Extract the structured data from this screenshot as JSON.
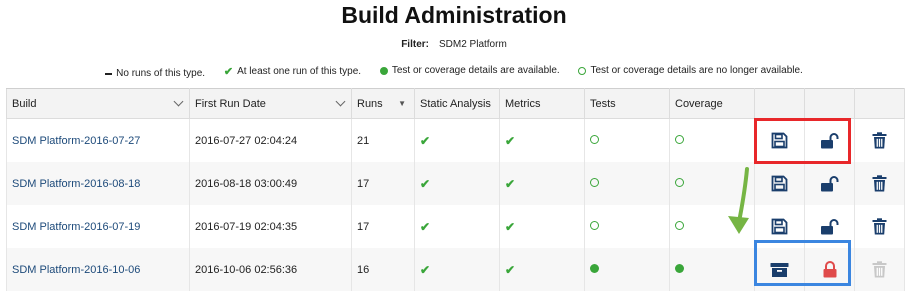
{
  "title": "Build Administration",
  "filter": {
    "label": "Filter:",
    "value": "SDM2 Platform"
  },
  "legend": [
    {
      "symbol": "dash-icon",
      "text": "No runs of this type."
    },
    {
      "symbol": "check-icon",
      "text": "At least one run of this type."
    },
    {
      "symbol": "filled-dot-icon",
      "text": "Test or coverage details are available."
    },
    {
      "symbol": "hollow-dot-icon",
      "text": "Test or coverage details are no longer available."
    }
  ],
  "columns": {
    "build": "Build",
    "first_run": "First Run Date",
    "runs": "Runs",
    "static": "Static Analysis",
    "metrics": "Metrics",
    "tests": "Tests",
    "coverage": "Coverage"
  },
  "rows": [
    {
      "build": "SDM Platform-2016-07-27",
      "first_run": "2016-07-27 02:04:24",
      "runs": "21",
      "static": "check",
      "metrics": "check",
      "tests": "hollow",
      "coverage": "hollow",
      "archive_state": "save",
      "lock_state": "unlocked",
      "delete_enabled": true
    },
    {
      "build": "SDM Platform-2016-08-18",
      "first_run": "2016-08-18 03:00:49",
      "runs": "17",
      "static": "check",
      "metrics": "check",
      "tests": "hollow",
      "coverage": "hollow",
      "archive_state": "save",
      "lock_state": "unlocked",
      "delete_enabled": true
    },
    {
      "build": "SDM Platform-2016-07-19",
      "first_run": "2016-07-19 02:04:35",
      "runs": "17",
      "static": "check",
      "metrics": "check",
      "tests": "hollow",
      "coverage": "hollow",
      "archive_state": "save",
      "lock_state": "unlocked",
      "delete_enabled": true
    },
    {
      "build": "SDM Platform-2016-10-06",
      "first_run": "2016-10-06 02:56:36",
      "runs": "16",
      "static": "check",
      "metrics": "check",
      "tests": "filled",
      "coverage": "filled",
      "archive_state": "archived",
      "lock_state": "locked",
      "delete_enabled": false
    }
  ],
  "colors": {
    "accent_green": "#3aa63a",
    "icon_navy": "#1a3e6c",
    "locked_red": "#e04b4b",
    "highlight_red": "#e8272a",
    "highlight_blue": "#3b86e0",
    "disabled_gray": "#c8c8c8"
  }
}
